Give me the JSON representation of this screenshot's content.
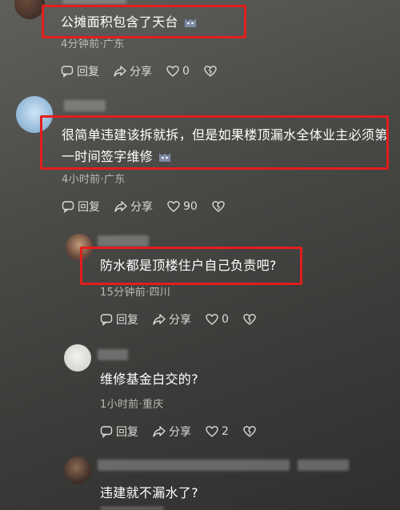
{
  "comments": [
    {
      "text": "公摊面积包含了天台",
      "meta": "4分钟前·广东",
      "reply": "回复",
      "share": "分享",
      "likes": "0"
    },
    {
      "text_line1": "很简单违建该拆就拆，但是如果楼顶漏水全体业主必须第",
      "text_line2": "一时间签字维修",
      "meta": "4小时前·广东",
      "reply": "回复",
      "share": "分享",
      "likes": "90"
    },
    {
      "text": "防水都是顶楼住户自己负责吧?",
      "meta": "15分钟前·四川",
      "reply": "回复",
      "share": "分享",
      "likes": "0"
    },
    {
      "text": "维修基金白交的?",
      "meta": "1小时前·重庆",
      "reply": "回复",
      "share": "分享",
      "likes": "2"
    },
    {
      "text": "违建就不漏水了?"
    }
  ],
  "colors": {
    "highlight": "#e41d1d",
    "meta": "#b9b9b6"
  },
  "icons": [
    "reply-icon",
    "share-icon",
    "heart-icon",
    "broken-heart-icon",
    "cat-emoji-icon"
  ]
}
